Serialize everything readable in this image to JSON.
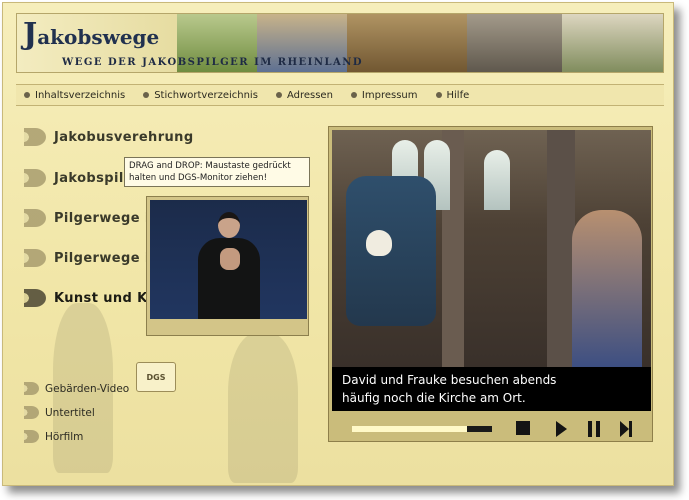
{
  "header": {
    "brand_initial": "J",
    "brand_rest": "akobswege",
    "tagline": "WEGE DER JAKOBSPILGER IM RHEINLAND"
  },
  "nav": [
    {
      "label": "Inhaltsverzeichnis"
    },
    {
      "label": "Stichwortverzeichnis"
    },
    {
      "label": "Adressen"
    },
    {
      "label": "Impressum"
    },
    {
      "label": "Hilfe"
    }
  ],
  "menu": [
    {
      "label": "Jakobusverehrung"
    },
    {
      "label": "Jakobspilg"
    },
    {
      "label": "Pilgerwege in"
    },
    {
      "label": "Pilgerwege in"
    },
    {
      "label": "Kunst und K"
    }
  ],
  "sub_menu": [
    {
      "label": "Gebärden-Video"
    },
    {
      "label": "Untertitel"
    },
    {
      "label": "Hörfilm"
    }
  ],
  "dgs_badge": "DGS",
  "tooltip": "DRAG and DROP: Maustaste gedrückt halten und DGS-Monitor ziehen!",
  "player": {
    "subtitle_line1": "David und Frauke besuchen abends",
    "subtitle_line2": "häufig noch die Kirche am Ort.",
    "progress": 0.82
  },
  "colors": {
    "background": "#f1e6a7",
    "subtitle_bg": "#000000",
    "progress_fill": "#fff9c8"
  }
}
